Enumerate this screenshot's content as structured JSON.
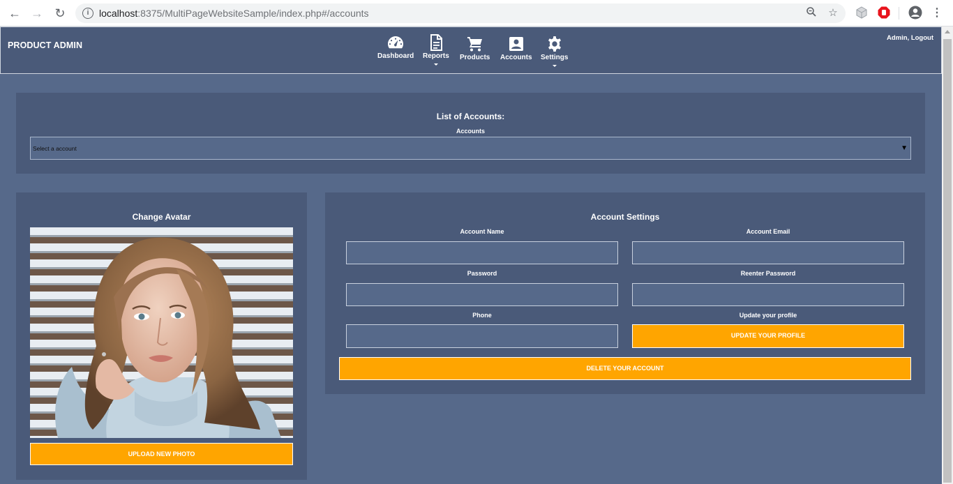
{
  "browser": {
    "url_host": "localhost",
    "url_rest": ":8375/MultiPageWebsiteSample/index.php#/accounts"
  },
  "header": {
    "brand": "PRODUCT ADMIN",
    "nav": [
      {
        "label": "Dashboard",
        "icon": "dashboard-icon",
        "dropdown": false
      },
      {
        "label": "Reports",
        "icon": "report-document-icon",
        "dropdown": true
      },
      {
        "label": "Products",
        "icon": "shopping-cart-icon",
        "dropdown": false
      },
      {
        "label": "Accounts",
        "icon": "account-box-icon",
        "dropdown": false
      },
      {
        "label": "Settings",
        "icon": "gear-icon",
        "dropdown": true
      }
    ],
    "user": "Admin, Logout"
  },
  "accounts_panel": {
    "title": "List of Accounts:",
    "label": "Accounts",
    "select_value": "Select a account"
  },
  "avatar_panel": {
    "title": "Change Avatar",
    "upload_label": "UPLOAD NEW PHOTO"
  },
  "settings_panel": {
    "title": "Account Settings",
    "account_name_label": "Account Name",
    "account_email_label": "Account Email",
    "password_label": "Password",
    "reenter_password_label": "Reenter Password",
    "phone_label": "Phone",
    "update_label": "Update your profile",
    "update_button": "UPDATE YOUR PROFILE",
    "delete_button": "DELETE YOUR ACCOUNT"
  },
  "colors": {
    "page_bg": "#56698a",
    "panel_bg": "#4a5a79",
    "accent": "#ffa500"
  }
}
